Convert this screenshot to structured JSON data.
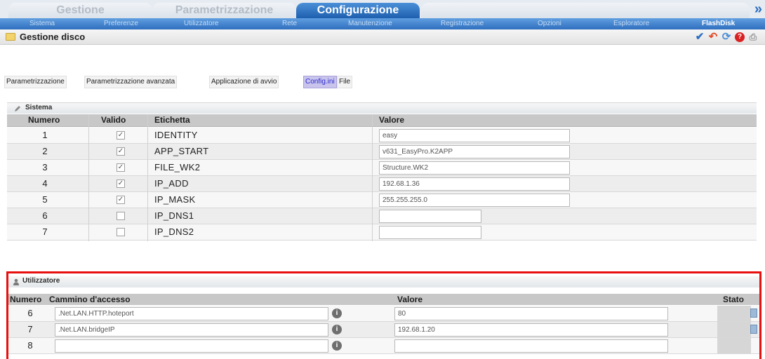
{
  "tabs": [
    {
      "label": "Gestione",
      "active": false
    },
    {
      "label": "Parametrizzazione",
      "active": false
    },
    {
      "label": "Configurazione",
      "active": true
    }
  ],
  "submenu": [
    {
      "label": "Sistema",
      "active": false
    },
    {
      "label": "Preferenze",
      "active": false
    },
    {
      "label": "Utilizzatore",
      "active": false
    },
    {
      "label": "Rete",
      "active": false
    },
    {
      "label": "Manutenzione",
      "active": false
    },
    {
      "label": "Registrazione",
      "active": false
    },
    {
      "label": "Opzioni",
      "active": false
    },
    {
      "label": "Esploratore",
      "active": false
    },
    {
      "label": "FlashDisk",
      "active": true
    }
  ],
  "header": {
    "title": "Gestione disco",
    "icons": [
      "checkmark-icon",
      "undo-icon",
      "refresh-icon",
      "help-icon",
      "print-icon"
    ]
  },
  "subtabs": [
    {
      "label": "Parametrizzazione",
      "active": false
    },
    {
      "label": "Parametrizzazione avanzata",
      "active": false
    },
    {
      "label": "Applicazione di avvio",
      "active": false
    },
    {
      "label": "Config.ini",
      "active": true
    },
    {
      "label": "File",
      "active": false
    }
  ],
  "sistema": {
    "section_title": "Sistema",
    "columns": {
      "numero": "Numero",
      "valido": "Valido",
      "etichetta": "Etichetta",
      "valore": "Valore"
    },
    "rows": [
      {
        "numero": "1",
        "valido": true,
        "etichetta": "IDENTITY",
        "valore": "easy"
      },
      {
        "numero": "2",
        "valido": true,
        "etichetta": "APP_START",
        "valore": "v631_EasyPro.K2APP"
      },
      {
        "numero": "3",
        "valido": true,
        "etichetta": "FILE_WK2",
        "valore": "Structure.WK2"
      },
      {
        "numero": "4",
        "valido": true,
        "etichetta": "IP_ADD",
        "valore": "192.68.1.36"
      },
      {
        "numero": "5",
        "valido": true,
        "etichetta": "IP_MASK",
        "valore": "255.255.255.0"
      },
      {
        "numero": "6",
        "valido": false,
        "etichetta": "IP_DNS1",
        "valore": ""
      },
      {
        "numero": "7",
        "valido": false,
        "etichetta": "IP_DNS2",
        "valore": ""
      }
    ]
  },
  "utilizzatore": {
    "section_title": "Utilizzatore",
    "columns": {
      "numero": "Numero",
      "cammino": "Cammino d'accesso",
      "valore": "Valore",
      "stato": "Stato"
    },
    "rows": [
      {
        "numero": "6",
        "cammino": ".Net.LAN.HTTP.hoteport",
        "valore": "80"
      },
      {
        "numero": "7",
        "cammino": ".Net.LAN.bridgeIP",
        "valore": "192.68.1.20"
      },
      {
        "numero": "8",
        "cammino": "",
        "valore": ""
      }
    ]
  },
  "colors": {
    "active_tab": "#2a72c6",
    "submenu": "#3f80cc",
    "highlight_frame": "#e80f0f",
    "active_subtab": "#c9c4ec"
  }
}
